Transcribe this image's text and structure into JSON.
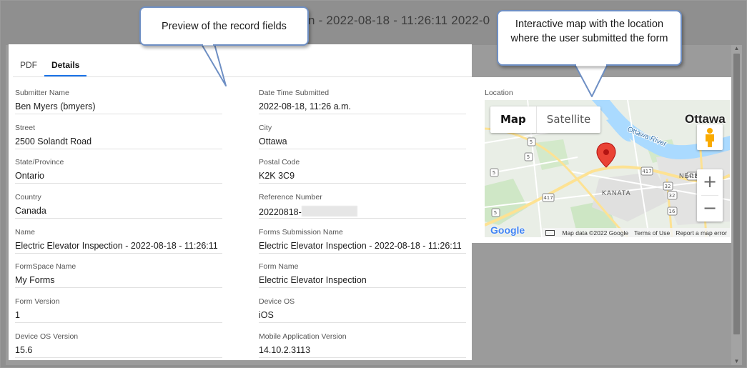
{
  "backdrop": {
    "title": "n - 2022-08-18 - 11:26:11 2022-0"
  },
  "tabs": [
    {
      "label": "PDF",
      "active": false
    },
    {
      "label": "Details",
      "active": true
    }
  ],
  "fields_left": [
    {
      "label": "Submitter Name",
      "value": "Ben Myers (bmyers)"
    },
    {
      "label": "Street",
      "value": "2500 Solandt Road"
    },
    {
      "label": "State/Province",
      "value": "Ontario"
    },
    {
      "label": "Country",
      "value": "Canada"
    },
    {
      "label": "Name",
      "value": "Electric Elevator Inspection - 2022-08-18 - 11:26:11"
    },
    {
      "label": "FormSpace Name",
      "value": "My Forms"
    },
    {
      "label": "Form Version",
      "value": "1"
    },
    {
      "label": "Device OS Version",
      "value": "15.6"
    }
  ],
  "fields_right": [
    {
      "label": "Date Time Submitted",
      "value": "2022-08-18, 11:26 a.m."
    },
    {
      "label": "City",
      "value": "Ottawa"
    },
    {
      "label": "Postal Code",
      "value": "K2K 3C9"
    },
    {
      "label": "Reference Number",
      "value": "20220818-"
    },
    {
      "label": "Forms Submission Name",
      "value": "Electric Elevator Inspection - 2022-08-18 - 11:26:11"
    },
    {
      "label": "Form Name",
      "value": "Electric Elevator Inspection"
    },
    {
      "label": "Device OS",
      "value": "iOS"
    },
    {
      "label": "Mobile Application Version",
      "value": "14.10.2.3113"
    }
  ],
  "map": {
    "label": "Location",
    "type_map": "Map",
    "type_satellite": "Satellite",
    "city": "Ottawa",
    "river": "Ottawa River",
    "area_kanata": "KANATA",
    "area_nepean": "NEPE",
    "zoom_in": "+",
    "zoom_out": "−",
    "google": "Google",
    "attribution": "Map data ©2022 Google",
    "terms": "Terms of Use",
    "report": "Report a map error",
    "route_labels": [
      "417",
      "417",
      "417",
      "5",
      "5",
      "5",
      "5",
      "32",
      "32",
      "16"
    ],
    "colors": {
      "pin": "#ea4335",
      "water": "#aadaff",
      "major_road": "#fde293",
      "park": "#c8e6c1"
    }
  },
  "callouts": {
    "preview": "Preview of the record fields",
    "map": "Interactive map with the location where the user submitted the form"
  },
  "colors": {
    "tab_active_underline": "#1a73e8",
    "callout_border": "#6e8fc4"
  }
}
